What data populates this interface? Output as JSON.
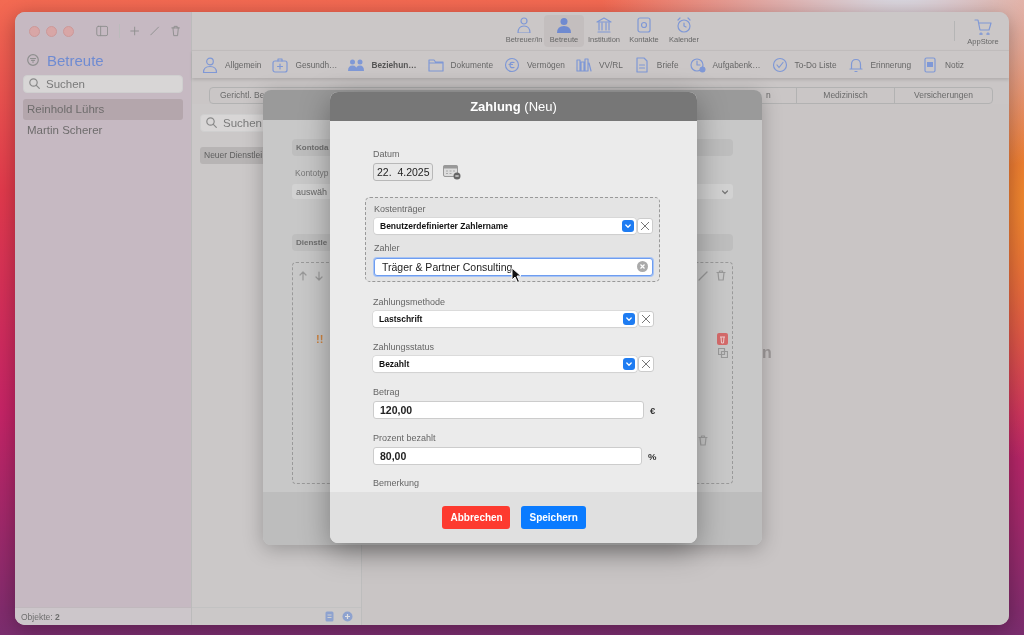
{
  "sidebar": {
    "title": "Betreute",
    "search_placeholder": "Suchen",
    "items": [
      {
        "label": "Reinhold Lührs",
        "selected": true
      },
      {
        "label": "Martin Scherer",
        "selected": false
      }
    ],
    "footer": "Objekte: **2**"
  },
  "toolbar": {
    "nav": [
      {
        "label": "Betreuer/in",
        "selected": false
      },
      {
        "label": "Betreute",
        "selected": true
      },
      {
        "label": "Institution",
        "selected": false
      },
      {
        "label": "Kontakte",
        "selected": false
      },
      {
        "label": "Kalender",
        "selected": false
      }
    ],
    "store": "AppStore"
  },
  "tabs": [
    {
      "label": "Allgemein",
      "selected": false
    },
    {
      "label": "Gesundh…",
      "selected": false
    },
    {
      "label": "Beziehun…",
      "selected": true
    },
    {
      "label": "Dokumente",
      "selected": false
    },
    {
      "label": "Vermögen",
      "selected": false
    },
    {
      "label": "VV/RL",
      "selected": false
    },
    {
      "label": "Briefe",
      "selected": false
    },
    {
      "label": "Aufgabenk…",
      "selected": false
    },
    {
      "label": "To-Do Liste",
      "selected": false
    },
    {
      "label": "Erinnerung",
      "selected": false
    },
    {
      "label": "Notiz",
      "selected": false
    }
  ],
  "segments": [
    {
      "label": "Gerichtl. Be",
      "selected": false,
      "kind": "cut"
    },
    {
      "label": "n",
      "selected": false,
      "kind": "tail"
    },
    {
      "label": "Medizinisch",
      "selected": false,
      "kind": "full"
    },
    {
      "label": "Versicherungen",
      "selected": false,
      "kind": "full"
    }
  ],
  "middle_column": {
    "search_placeholder": "Suchen",
    "items": [
      {
        "label": "Neuer Dienstlei",
        "selected": true
      }
    ]
  },
  "background_sheet": {
    "section_1": "Kontoda",
    "field_label": "Kontotyp",
    "field_value": "auswäh",
    "section_2": "Dienstle",
    "flag": "!!"
  },
  "right_panel": {
    "text": "n"
  },
  "dialog": {
    "title": "**Zahlung** (Neu)",
    "date": {
      "label": "Datum",
      "value": "22.  4.2025"
    },
    "payer_group": {
      "cost_bearer": {
        "label": "Kostenträger",
        "value": "Benutzerdefinierter Zahlername"
      },
      "payer": {
        "label": "Zahler",
        "value": "Träger & Partner Consulting",
        "focused": true
      }
    },
    "payment_method": {
      "label": "Zahlungsmethode",
      "value": "Lastschrift"
    },
    "payment_status": {
      "label": "Zahlungsstatus",
      "value": "Bezahlt"
    },
    "amount": {
      "label": "Betrag",
      "value": "120,00",
      "unit": "€"
    },
    "percent_paid": {
      "label": "Prozent bezahlt",
      "value": "80,00",
      "unit": "%"
    },
    "remark_label": "Bemerkung",
    "buttons": [
      {
        "label": "Abbrechen",
        "kind": "cancel"
      },
      {
        "label": "Speichern",
        "kind": "save"
      }
    ]
  }
}
